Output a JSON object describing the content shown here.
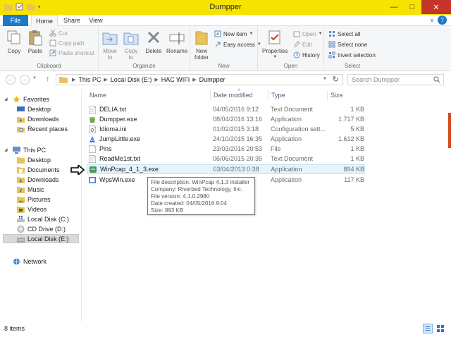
{
  "window": {
    "title": "Dumpper",
    "controls": {
      "minimize": "—",
      "maximize": "□",
      "close": "✕"
    }
  },
  "ribbon_tabs": {
    "file": "File",
    "home": "Home",
    "share": "Share",
    "view": "View",
    "help": "?"
  },
  "ribbon": {
    "clipboard": {
      "label": "Clipboard",
      "copy": "Copy",
      "paste": "Paste",
      "cut": "Cut",
      "copy_path": "Copy path",
      "paste_shortcut": "Paste shortcut"
    },
    "organize": {
      "label": "Organize",
      "move_to_1": "Move",
      "move_to_2": "to",
      "copy_to_1": "Copy",
      "copy_to_2": "to",
      "delete": "Delete",
      "rename": "Rename"
    },
    "new": {
      "label": "New",
      "new_folder_1": "New",
      "new_folder_2": "folder",
      "new_item": "New item",
      "easy_access": "Easy access"
    },
    "open": {
      "label": "Open",
      "properties": "Properties",
      "open": "Open",
      "edit": "Edit",
      "history": "History"
    },
    "select": {
      "label": "Select",
      "select_all": "Select all",
      "select_none": "Select none",
      "invert_selection": "Invert selection"
    }
  },
  "address": {
    "crumbs": [
      "This PC",
      "Local Disk (E:)",
      "HAC WIFI",
      "Dumpper"
    ],
    "search_placeholder": "Search Dumpper"
  },
  "nav": {
    "favorites": "Favorites",
    "desktop": "Desktop",
    "downloads": "Downloads",
    "recent_places": "Recent places",
    "this_pc": "This PC",
    "pc_desktop": "Desktop",
    "documents": "Documents",
    "pc_downloads": "Downloads",
    "music": "Music",
    "pictures": "Pictures",
    "videos": "Videos",
    "local_disk_c": "Local Disk (C:)",
    "cd_drive_d": "CD Drive (D:)",
    "local_disk_e": "Local Disk (E:)",
    "network": "Network"
  },
  "columns": {
    "name": "Name",
    "date": "Date modified",
    "type": "Type",
    "size": "Size"
  },
  "files": [
    {
      "name": "DELIA.txt",
      "date": "04/05/2016 9:12",
      "type": "Text Document",
      "size": "1 KB",
      "icon": "text-file-icon"
    },
    {
      "name": "Dumpper.exe",
      "date": "08/04/2016 13:16",
      "type": "Application",
      "size": "1.717 KB",
      "icon": "dumpper-app-icon"
    },
    {
      "name": "Idioma.ini",
      "date": "01/02/2015 3:18",
      "type": "Configuration sett...",
      "size": "5 KB",
      "icon": "ini-file-icon"
    },
    {
      "name": "JumpLittle.exe",
      "date": "24/10/2015 16:35",
      "type": "Application",
      "size": "1.612 KB",
      "icon": "jumpstart-app-icon"
    },
    {
      "name": "Pins",
      "date": "23/03/2016 20:53",
      "type": "File",
      "size": "1 KB",
      "icon": "blank-file-icon"
    },
    {
      "name": "ReadMe1st.txt",
      "date": "06/06/2015 20:35",
      "type": "Text Document",
      "size": "1 KB",
      "icon": "text-file-icon"
    },
    {
      "name": "WinPcap_4_1_3.exe",
      "date": "03/04/2013 0:38",
      "type": "Application",
      "size": "894 KB",
      "icon": "winpcap-app-icon"
    },
    {
      "name": "WpsWin.exe",
      "date": "",
      "type": "Application",
      "size": "117 KB",
      "icon": "wpswin-app-icon"
    }
  ],
  "tooltip": {
    "line1": "File description: WinPcap 4.1.3 installer",
    "line2": "Company: Riverbed Technology, Inc.",
    "line3": "File version: 4.1.0.2980",
    "line4": "Date created: 04/05/2016 9:04",
    "line5": "Size: 893 KB"
  },
  "status": {
    "item_count": "8 items"
  },
  "colors": {
    "title_bar": "#f7e300",
    "file_tab": "#1979ca",
    "close_button": "#c7352a",
    "hover_row": "#e5f3fb",
    "folder": "#e8c35a"
  }
}
